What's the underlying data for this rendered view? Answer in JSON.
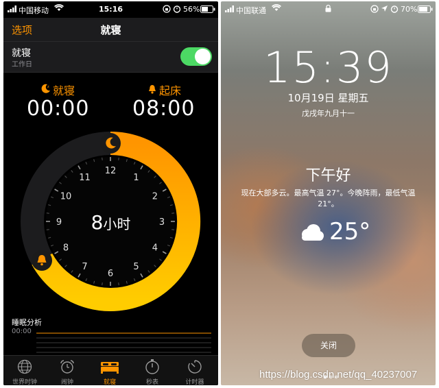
{
  "left_phone": {
    "status": {
      "carrier": "中国移动",
      "time": "15:16",
      "battery": "56%"
    },
    "nav": {
      "left_button": "选项",
      "title": "就寝"
    },
    "bedtime_row": {
      "title": "就寝",
      "subtitle": "工作日",
      "toggle_on": true
    },
    "bedtime": {
      "label": "就寝",
      "time": "00:00",
      "icon": "moon-icon"
    },
    "wake": {
      "label": "起床",
      "time": "08:00",
      "icon": "bell-icon"
    },
    "dial": {
      "duration_number": "8",
      "duration_unit": "小时",
      "hours": [
        "12",
        "1",
        "2",
        "3",
        "4",
        "5",
        "6",
        "7",
        "8",
        "9",
        "10",
        "11"
      ],
      "accent_start": "#ff9500",
      "accent_end": "#ffcc00"
    },
    "analysis": {
      "title": "睡眠分析",
      "time": "00:00"
    },
    "tabs": [
      {
        "label": "世界时钟",
        "icon": "globe-icon",
        "active": false
      },
      {
        "label": "闹钟",
        "icon": "alarm-clock-icon",
        "active": false
      },
      {
        "label": "就寝",
        "icon": "bed-icon",
        "active": true
      },
      {
        "label": "秒表",
        "icon": "stopwatch-icon",
        "active": false
      },
      {
        "label": "计时器",
        "icon": "timer-icon",
        "active": false
      }
    ]
  },
  "right_phone": {
    "status": {
      "carrier": "中国联通",
      "battery": "70%"
    },
    "clock": "15:39",
    "date": "10月19日 星期五",
    "lunar_date": "戊戌年九月十一",
    "greeting": "下午好",
    "weather_text": "现在大部多云。最高气温 27°。今晚阵雨，最低气温 21°。",
    "temperature": "25°",
    "weather_icon": "cloud-icon",
    "close_button": "关闭"
  },
  "watermark": "https://blog.csdn.net/qq_40237007"
}
